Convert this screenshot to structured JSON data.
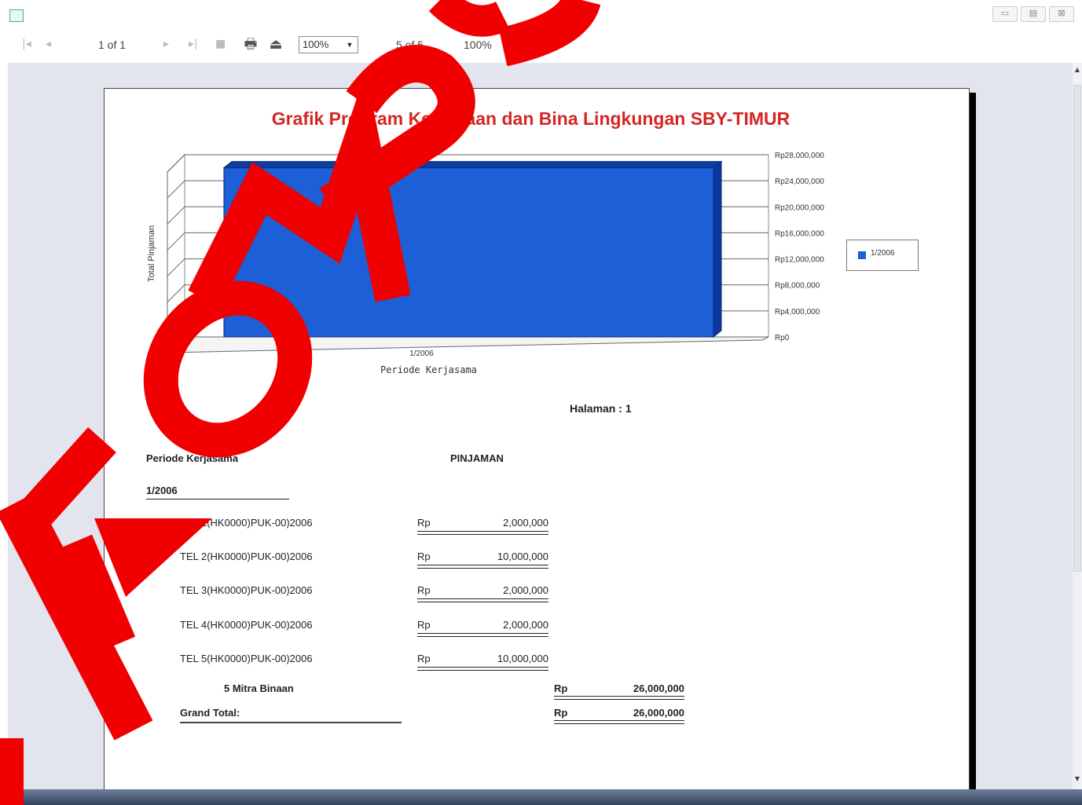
{
  "toolbar": {
    "page_indicator": "1 of 1",
    "zoom_value": "100%",
    "records": "5 of 5",
    "percent": "100%",
    "window_buttons": [
      "▭",
      "▤",
      "⊠"
    ]
  },
  "report": {
    "title": "Grafik Program Kemitraan dan Bina Lingkungan SBY-TIMUR",
    "halaman_label": "Halaman :",
    "halaman_value": "1",
    "header_left": "Periode Kerjasama",
    "header_mid": "PINJAMAN",
    "group_label": "1/2006",
    "rows": [
      {
        "name": "TEL 1(HK0000)PUK-00)2006",
        "currency": "Rp",
        "amount": "2,000,000"
      },
      {
        "name": "TEL 2(HK0000)PUK-00)2006",
        "currency": "Rp",
        "amount": "10,000,000"
      },
      {
        "name": "TEL 3(HK0000)PUK-00)2006",
        "currency": "Rp",
        "amount": "2,000,000"
      },
      {
        "name": "TEL 4(HK0000)PUK-00)2006",
        "currency": "Rp",
        "amount": "2,000,000"
      },
      {
        "name": "TEL 5(HK0000)PUK-00)2006",
        "currency": "Rp",
        "amount": "10,000,000"
      }
    ],
    "subtotal": {
      "label": "5  Mitra Binaan",
      "currency": "Rp",
      "amount": "26,000,000"
    },
    "grand_total": {
      "label": "Grand Total:",
      "currency": "Rp",
      "amount": "26,000,000"
    }
  },
  "chart_data": {
    "type": "bar",
    "title": "Grafik Program Kemitraan dan Bina Lingkungan SBY-TIMUR",
    "categories": [
      "1/2006"
    ],
    "series": [
      {
        "name": "1/2006",
        "values": [
          26000000
        ]
      }
    ],
    "xlabel": "Periode Kerjasama",
    "ylabel": "Total Pinjaman",
    "ylim": [
      0,
      28000000
    ],
    "y_tick_labels": [
      "Rp0",
      "Rp4,000,000",
      "Rp8,000,000",
      "Rp12,000,000",
      "Rp16,000,000",
      "Rp20,000,000",
      "Rp24,000,000",
      "Rp28,000,000"
    ],
    "y_ticks": [
      0,
      4000000,
      8000000,
      12000000,
      16000000,
      20000000,
      24000000,
      28000000
    ],
    "grid": true,
    "legend": "right",
    "color": "#1c5fd6"
  },
  "colors": {
    "title_red": "#d42626",
    "bar_blue": "#1c5fd6",
    "watermark_red": "#f00000"
  },
  "watermark_text": "STIKOMPS"
}
